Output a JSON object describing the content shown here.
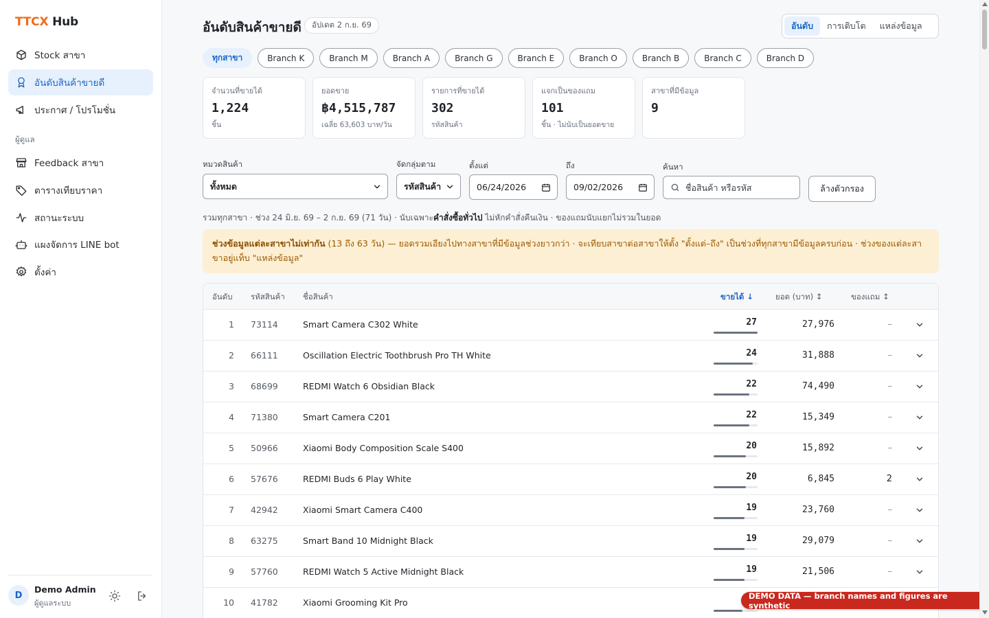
{
  "brand": {
    "part1": "TTCX",
    "part2": "Hub"
  },
  "sidebar": {
    "items": [
      {
        "label": "Stock สาขา",
        "icon": "box-icon"
      },
      {
        "label": "อันดับสินค้าขายดี",
        "icon": "award-icon"
      },
      {
        "label": "ประกาศ / โปรโมชั่น",
        "icon": "megaphone-icon"
      },
      {
        "label": "Feedback สาขา",
        "icon": "store-icon"
      },
      {
        "label": "ตารางเทียบราคา",
        "icon": "tag-icon"
      },
      {
        "label": "สถานะระบบ",
        "icon": "activity-icon"
      },
      {
        "label": "แผงจัดการ LINE bot",
        "icon": "bot-icon"
      },
      {
        "label": "ตั้งค่า",
        "icon": "gear-icon"
      }
    ],
    "section_admin": "ผู้ดูแล",
    "active_index": 1
  },
  "user": {
    "initial": "D",
    "name": "Demo Admin",
    "role": "ผู้ดูแลระบบ"
  },
  "header": {
    "title": "อันดับสินค้าขายดี",
    "updated": "อัปเดต 2 ก.ย. 69",
    "tabs": [
      "อันดับ",
      "การเติบโต",
      "แหล่งข้อมูล"
    ]
  },
  "branches": [
    "ทุกสาขา",
    "Branch K",
    "Branch M",
    "Branch A",
    "Branch G",
    "Branch E",
    "Branch O",
    "Branch B",
    "Branch C",
    "Branch D"
  ],
  "stats": [
    {
      "label": "จำนวนที่ขายได้",
      "value": "1,224",
      "sub": "ชิ้น"
    },
    {
      "label": "ยอดขาย",
      "value": "฿4,515,787",
      "sub": "เฉลี่ย 63,603 บาท/วัน"
    },
    {
      "label": "รายการที่ขายได้",
      "value": "302",
      "sub": "รหัสสินค้า"
    },
    {
      "label": "แจกเป็นของแถม",
      "value": "101",
      "sub": "ชิ้น · ไม่นับเป็นยอดขาย"
    },
    {
      "label": "สาขาที่มีข้อมูล",
      "value": "9",
      "sub": ""
    }
  ],
  "filters": {
    "category_label": "หมวดสินค้า",
    "category_value": "ทั้งหมด",
    "group_label": "จัดกลุ่มตาม",
    "group_value": "รหัสสินค้า",
    "from_label": "ตั้งแต่",
    "from_value": "06/24/2026",
    "to_label": "ถึง",
    "to_value": "09/02/2026",
    "search_label": "ค้นหา",
    "search_placeholder": "ชื่อสินค้า หรือรหัส",
    "clear_label": "ล้างตัวกรอง"
  },
  "summary": {
    "pre": "รวมทุกสาขา · ช่วง 24 มิ.ย. 69 – 2 ก.ย. 69 (71 วัน) · นับเฉพาะ",
    "bold": "คำสั่งซื้อทั่วไป",
    "post": " ไม่หักคำสั่งคืนเงิน · ของแถมนับแยกไม่รวมในยอด"
  },
  "warning": {
    "bold": "ช่วงข้อมูลแต่ละสาขาไม่เท่ากัน",
    "text": " (13 ถึง 63 วัน) — ยอดรวมเอียงไปทางสาขาที่มีข้อมูลช่วงยาวกว่า · จะเทียบสาขาต่อสาขาให้ตั้ง \"ตั้งแต่–ถึง\" เป็นช่วงที่ทุกสาขามีข้อมูลครบก่อน · ช่วงของแต่ละสาขาอยู่แท็บ \"แหล่งข้อมูล\""
  },
  "table": {
    "headers": {
      "rank": "อันดับ",
      "code": "รหัสสินค้า",
      "name": "ชื่อสินค้า",
      "sold": "ขายได้ ↓",
      "amount": "ยอด (บาท) ↕",
      "gift": "ของแถม ↕"
    },
    "rows": [
      {
        "rank": "1",
        "code": "73114",
        "name": "Smart Camera C302 White",
        "sold": "27",
        "sold_fraction": 1.0,
        "amount": "27,976",
        "gift": "–"
      },
      {
        "rank": "2",
        "code": "66111",
        "name": "Oscillation Electric Toothbrush Pro TH White",
        "sold": "24",
        "sold_fraction": 0.89,
        "amount": "31,888",
        "gift": "–"
      },
      {
        "rank": "3",
        "code": "68699",
        "name": "REDMI Watch 6 Obsidian Black",
        "sold": "22",
        "sold_fraction": 0.81,
        "amount": "74,490",
        "gift": "–"
      },
      {
        "rank": "4",
        "code": "71380",
        "name": "Smart Camera C201",
        "sold": "22",
        "sold_fraction": 0.81,
        "amount": "15,349",
        "gift": "–"
      },
      {
        "rank": "5",
        "code": "50966",
        "name": "Xiaomi Body Composition Scale S400",
        "sold": "20",
        "sold_fraction": 0.74,
        "amount": "15,892",
        "gift": "–"
      },
      {
        "rank": "6",
        "code": "57676",
        "name": "REDMI Buds 6 Play White",
        "sold": "20",
        "sold_fraction": 0.74,
        "amount": "6,845",
        "gift": "2"
      },
      {
        "rank": "7",
        "code": "42942",
        "name": "Xiaomi Smart Camera C400",
        "sold": "19",
        "sold_fraction": 0.7,
        "amount": "23,760",
        "gift": "–"
      },
      {
        "rank": "8",
        "code": "63275",
        "name": "Smart Band 10 Midnight Black",
        "sold": "19",
        "sold_fraction": 0.7,
        "amount": "29,079",
        "gift": "–"
      },
      {
        "rank": "9",
        "code": "57760",
        "name": "REDMI Watch 5 Active Midnight Black",
        "sold": "19",
        "sold_fraction": 0.7,
        "amount": "21,506",
        "gift": "–"
      },
      {
        "rank": "10",
        "code": "41782",
        "name": "Xiaomi Grooming Kit Pro",
        "sold": "",
        "sold_fraction": 0.66,
        "amount": "",
        "gift": ""
      }
    ]
  },
  "demo_banner": "DEMO DATA — branch names and figures are synthetic",
  "colors": {
    "accent": "#1a66c9",
    "accent_bg": "#e7f1fd",
    "brand_orange": "#ef6c1a",
    "warning_bg": "#fdefd3",
    "danger": "#c9281e"
  }
}
